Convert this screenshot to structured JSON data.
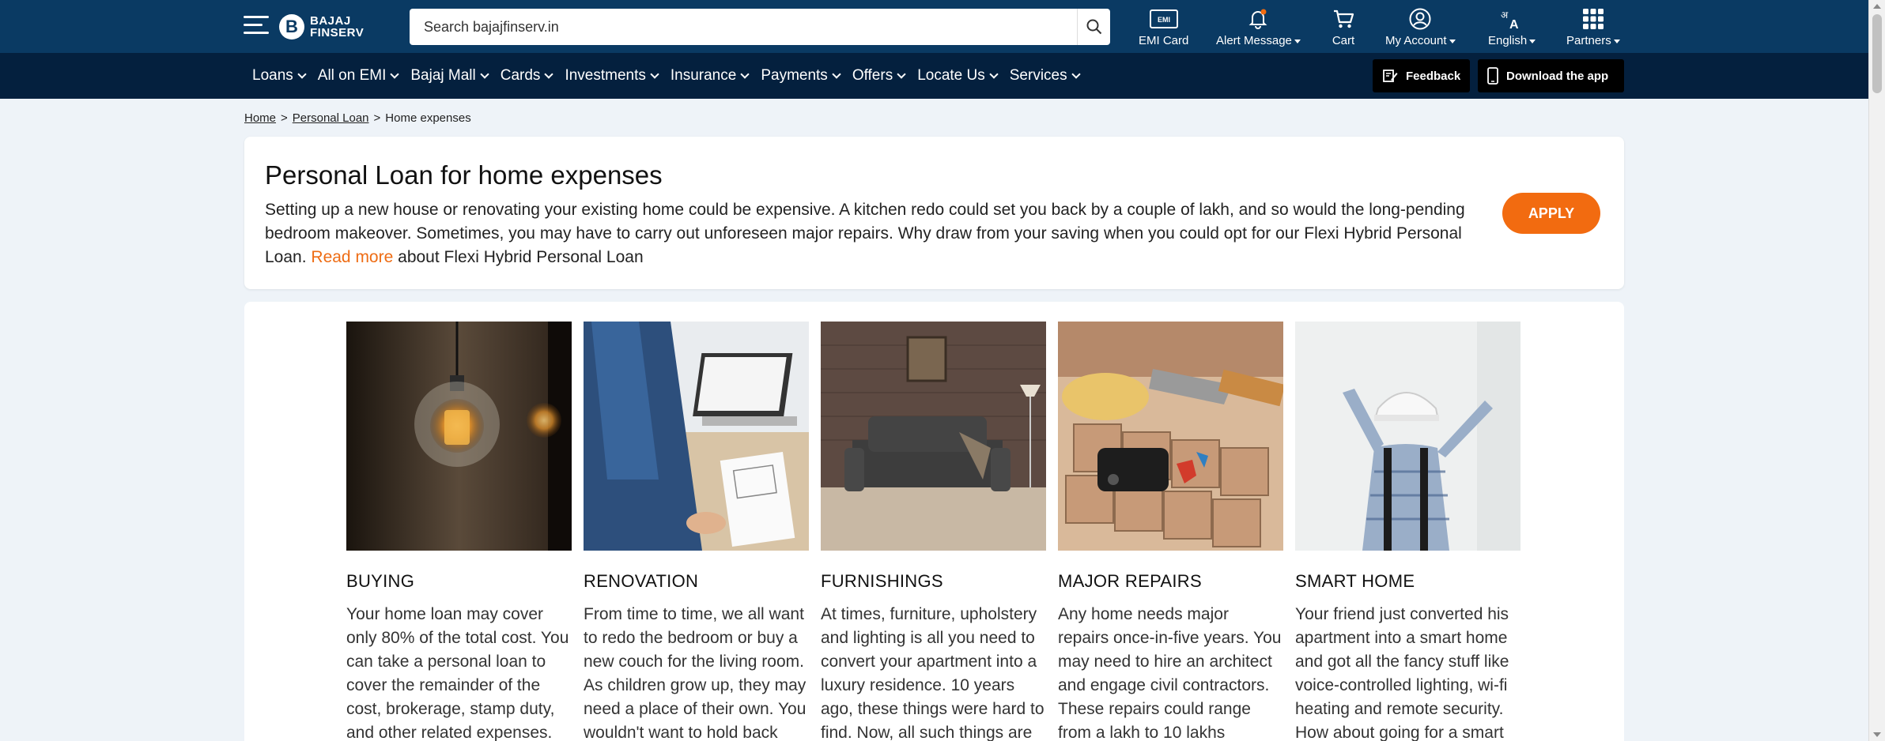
{
  "header": {
    "search_placeholder": "Search bajajfinserv.in",
    "logo_line1": "BAJAJ",
    "logo_line2": "FINSERV",
    "items": [
      {
        "label": "EMI Card",
        "icon": "emi-card-icon"
      },
      {
        "label": "Alert Message",
        "icon": "bell-icon"
      },
      {
        "label": "Cart",
        "icon": "cart-icon"
      },
      {
        "label": "My Account",
        "icon": "account-icon"
      },
      {
        "label": "English",
        "icon": "language-icon"
      },
      {
        "label": "Partners",
        "icon": "grid-icon"
      }
    ],
    "emi_badge": "EMI"
  },
  "nav": {
    "items": [
      "Loans",
      "All on EMI",
      "Bajaj Mall",
      "Cards",
      "Investments",
      "Insurance",
      "Payments",
      "Offers",
      "Locate Us",
      "Services"
    ],
    "feedback": "Feedback",
    "download": "Download the app"
  },
  "breadcrumb": [
    "Home",
    "Personal Loan",
    "Home expenses"
  ],
  "intro": {
    "title": "Personal Loan for home expenses",
    "body": "Setting up a new house or renovating your existing home could be expensive. A kitchen redo could set you back by a couple of lakh, and so would the long-pending bedroom makeover. Sometimes, you may have to carry out unforeseen major repairs. Why draw from your saving when you could opt for our Flexi Hybrid Personal Loan.",
    "link": "Read more",
    "tail": "about Flexi Hybrid Personal Loan",
    "apply": "APPLY"
  },
  "cards": [
    {
      "title": "BUYING",
      "text": "Your home loan may cover only 80% of the total cost. You can take a personal loan to cover the remainder of the cost, brokerage, stamp duty, and other related expenses."
    },
    {
      "title": "RENOVATION",
      "text": "From time to time, we all want to redo the bedroom or buy a new couch for the living room. As children grow up, they may need a place of their own. You wouldn't want to hold back"
    },
    {
      "title": "FURNISHINGS",
      "text": "At times, furniture, upholstery and lighting is all you need to convert your apartment into a luxury residence. 10 years ago, these things were hard to find. Now, all such things are"
    },
    {
      "title": "MAJOR REPAIRS",
      "text": "Any home needs major repairs once-in-five years. You may need to hire an architect and engage civil contractors. These repairs could range from a lakh to 10 lakhs"
    },
    {
      "title": "SMART HOME",
      "text": "Your friend just converted his apartment into a smart home and got all the fancy stuff like voice-controlled lighting, wi-fi heating and remote security. How about going for a smart"
    }
  ],
  "colors": {
    "header": "#0a3a63",
    "nav": "#04203e",
    "accent": "#f26b10",
    "link": "#ee6c14"
  }
}
